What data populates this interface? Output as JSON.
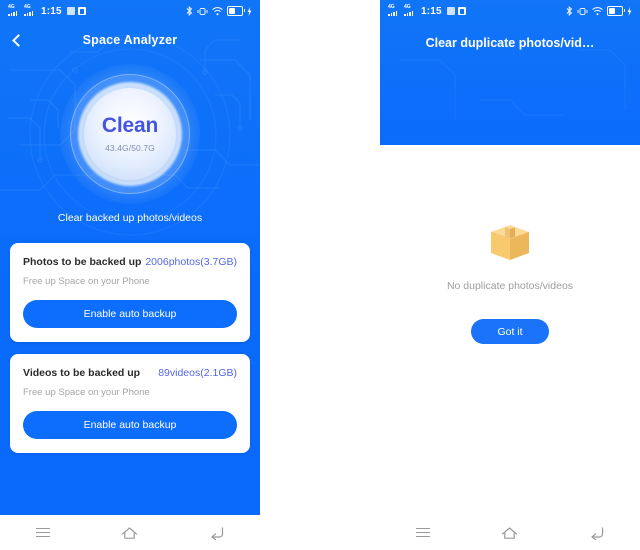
{
  "status_bar": {
    "time": "1:15",
    "network_label": "4G",
    "icons": [
      "signal-4g-icon",
      "signal-4g-icon",
      "app-badge-icon",
      "app-badge-icon",
      "bluetooth-icon",
      "vibrate-icon",
      "wifi-icon",
      "battery-icon",
      "charging-icon"
    ]
  },
  "left_screen": {
    "title": "Space Analyzer",
    "back_icon": "chevron-left-icon",
    "gauge": {
      "label": "Clean",
      "usage": "43.4G/50.7G",
      "used": "43.4G",
      "total": "50.7G"
    },
    "caption": "Clear backed up photos/videos",
    "cards": [
      {
        "title": "Photos to be backed up",
        "value": "2006photos(3.7GB)",
        "subtitle": "Free up Space on your Phone",
        "button": "Enable auto backup"
      },
      {
        "title": "Videos to be backed up",
        "value": "89videos(2.1GB)",
        "subtitle": "Free up Space on your Phone",
        "button": "Enable auto backup"
      }
    ]
  },
  "right_screen": {
    "title": "Clear duplicate photos/vid…",
    "empty_icon": "package-box-icon",
    "empty_text": "No duplicate photos/videos",
    "button": "Got it"
  },
  "nav_bar": {
    "recent_label": "recent-apps-icon",
    "home_label": "home-icon",
    "back_label": "back-icon"
  },
  "colors": {
    "brand_blue": "#0d6efd",
    "accent_purple": "#5566ea",
    "box_orange": "#f7c96a",
    "muted_gray": "#9e9e9e"
  }
}
